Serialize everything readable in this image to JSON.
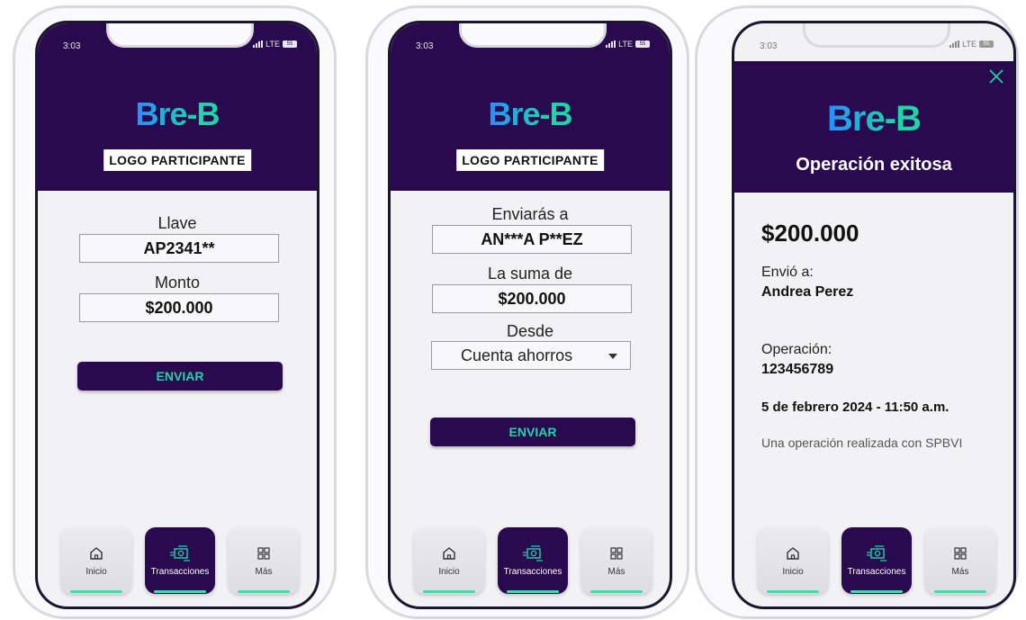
{
  "status": {
    "time": "3:03",
    "network": "LTE",
    "battery": "55"
  },
  "brand": {
    "logo": "Bre-B",
    "participant": "LOGO PARTICIPANTE"
  },
  "screen1": {
    "key_label": "Llave",
    "key_value": "AP2341**",
    "amount_label": "Monto",
    "amount_value": "$200.000",
    "send_label": "ENVIAR"
  },
  "screen2": {
    "to_label": "Enviarás a",
    "to_value": "AN***A P**EZ",
    "sum_label": "La suma de",
    "sum_value": "$200.000",
    "from_label": "Desde",
    "from_value": "Cuenta ahorros",
    "send_label": "ENVIAR"
  },
  "screen3": {
    "title": "Operación exitosa",
    "amount": "$200.000",
    "sent_to_label": "Envió a:",
    "sent_to_value": "Andrea Perez",
    "operation_label": "Operación:",
    "operation_value": "123456789",
    "datetime": "5 de febrero 2024 - 11:50 a.m.",
    "note": "Una operación realizada con SPBVI"
  },
  "nav": [
    {
      "label": "Inicio",
      "icon": "home-icon"
    },
    {
      "label": "Transacciones",
      "icon": "transactions-icon",
      "active": true
    },
    {
      "label": "Más",
      "icon": "grid-icon"
    }
  ],
  "colors": {
    "primary": "#2a0a4e",
    "accent": "#1fd4a8",
    "accent_line": "#2ee6a6",
    "logo_blue": "#2a8cff"
  }
}
